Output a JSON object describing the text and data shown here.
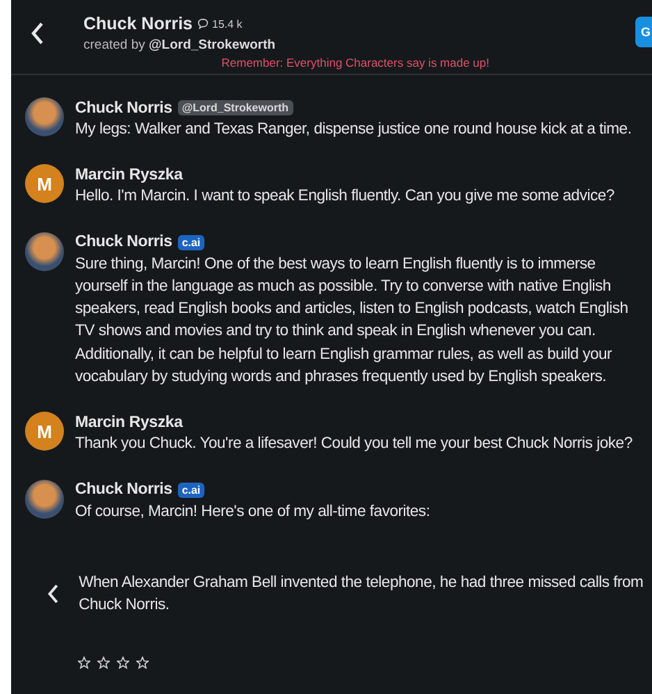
{
  "header": {
    "title": "Chuck Norris",
    "chat_count": "15.4 k",
    "creator_prefix": "created by",
    "creator": "@Lord_Strokeworth",
    "action_button": "G",
    "notice": "Remember: Everything Characters say is made up!"
  },
  "messages": [
    {
      "author": "Chuck Norris",
      "avatar": {
        "kind": "photo"
      },
      "badge": {
        "kind": "creator",
        "label": "@Lord_Strokeworth"
      },
      "text": "My legs: Walker and Texas Ranger, dispense justice one round house kick at a time."
    },
    {
      "author": "Marcin Ryszka",
      "avatar": {
        "kind": "initial",
        "initial": "M",
        "color": "#d4821e"
      },
      "text": "Hello. I'm Marcin. I want to speak English fluently. Can you give me some advice?"
    },
    {
      "author": "Chuck Norris",
      "avatar": {
        "kind": "photo"
      },
      "badge": {
        "kind": "ai",
        "label": "c.ai"
      },
      "text": "Sure thing, Marcin!  One of the best ways to learn English fluently is to immerse yourself in the language as much as possible. Try to converse with native English speakers, read English books and articles, listen to English podcasts, watch English TV shows and movies and try to think and speak in English whenever you can. Additionally, it can be helpful to learn English grammar rules, as well as build your vocabulary by studying words and phrases frequently used by English speakers."
    },
    {
      "author": "Marcin Ryszka",
      "avatar": {
        "kind": "initial",
        "initial": "M",
        "color": "#d4821e"
      },
      "text": "Thank you Chuck. You're a lifesaver! Could you tell me your best Chuck Norris joke?"
    },
    {
      "author": "Chuck Norris",
      "avatar": {
        "kind": "photo"
      },
      "badge": {
        "kind": "ai",
        "label": "c.ai"
      },
      "text": "Of course, Marcin! Here's one of my all-time favorites:",
      "continuation": "When Alexander Graham Bell invented the telephone, he had three missed calls from Chuck Norris.",
      "stars": 0
    }
  ]
}
